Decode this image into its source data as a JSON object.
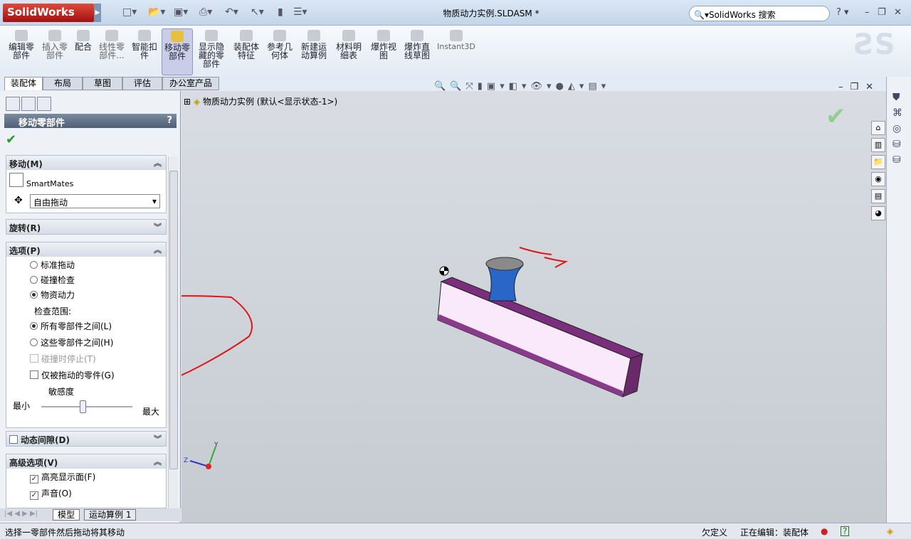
{
  "app": {
    "logo": "SolidWorks",
    "title": "物质动力实例.SLDASM *",
    "search_placeholder": "SolidWorks 搜索"
  },
  "toolbar": [
    {
      "label": "编辑零部件"
    },
    {
      "label": "插入零部件"
    },
    {
      "label": "配合"
    },
    {
      "label": "线性零部件..."
    },
    {
      "label": "智能扣件"
    },
    {
      "label": "移动零部件",
      "active": true
    },
    {
      "label": "显示隐藏的零部件"
    },
    {
      "label": "装配体特征"
    },
    {
      "label": "参考几何体"
    },
    {
      "label": "新建运动算例"
    },
    {
      "label": "材料明细表"
    },
    {
      "label": "爆炸视图"
    },
    {
      "label": "爆炸直线草图"
    },
    {
      "label": "Instant3D"
    }
  ],
  "tabs": [
    "装配体",
    "布局",
    "草图",
    "评估",
    "办公室产品"
  ],
  "property_manager": {
    "title": "移动零部件",
    "help": "?",
    "move": {
      "header": "移动(M)",
      "smartmates": "SmartMates",
      "mode": "自由拖动"
    },
    "rotate": {
      "header": "旋转(R)"
    },
    "options": {
      "header": "选项(P)",
      "standard_drag": "标准拖动",
      "collision_detection": "碰撞检查",
      "physical_dynamics": "物资动力",
      "check_range": "检查范围:",
      "between_all": "所有零部件之间(L)",
      "between_these": "这些零部件之间(H)",
      "stop_at_collision": "碰撞时停止(T)",
      "dragged_only": "仅被拖动的零件(G)",
      "sensitivity": "敏感度",
      "min": "最小",
      "max": "最大",
      "sensitivity_value": 0.45
    },
    "dynamic_clearance": {
      "header": "动态间隙(D)"
    },
    "advanced": {
      "header": "高级选项(V)",
      "highlight_faces": "高亮显示面(F)",
      "sound": "声音(O)"
    }
  },
  "bottom_tabs": [
    "模型",
    "运动算例 1"
  ],
  "tree": {
    "root": "物质动力实例 (默认<显示状态-1>)"
  },
  "status": {
    "message": "选择一零部件然后拖动将其移动",
    "state": "欠定义",
    "editing": "正在编辑：装配体"
  }
}
